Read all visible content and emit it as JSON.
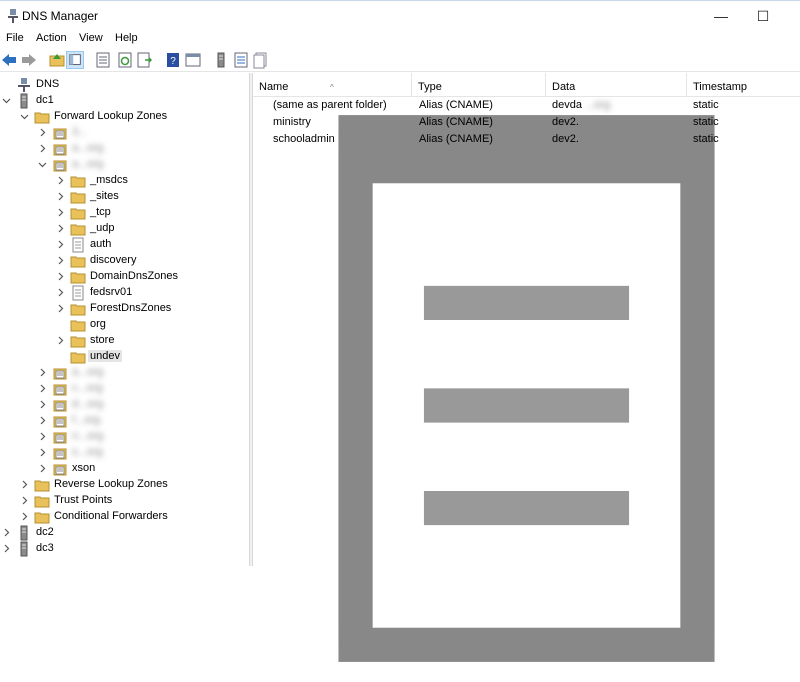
{
  "window": {
    "title": "DNS Manager",
    "minimize": "—",
    "maximize": "☐"
  },
  "menu": [
    "File",
    "Action",
    "View",
    "Help"
  ],
  "toolbar": [
    "back-arrow-icon",
    "forward-arrow-icon",
    "up-folder-icon",
    "show-tree-icon",
    "properties-icon",
    "refresh-icon",
    "export-list-icon",
    "help-icon",
    "console-icon",
    "server-icon",
    "list-icon",
    "document-icon"
  ],
  "tree": {
    "root": "DNS",
    "dc1": "dc1",
    "forward_lookup_zones": "Forward Lookup Zones",
    "zones": [
      {
        "label": "3..."
      },
      {
        "label": "a...org"
      },
      {
        "label": "a...org"
      }
    ],
    "subfolders": [
      "_msdcs",
      "_sites",
      "_tcp",
      "_udp",
      "auth",
      "discovery",
      "DomainDnsZones",
      "fedsrv01",
      "ForestDnsZones",
      "org",
      "store",
      "undev"
    ],
    "more_zones": [
      "a...org",
      "c...org",
      "d...org",
      "f...org",
      "n...org",
      "s...org",
      "xson"
    ],
    "reverse_lookup_zones": "Reverse Lookup Zones",
    "trust_points": "Trust Points",
    "conditional_forwarders": "Conditional Forwarders",
    "dc2": "dc2",
    "dc3": "dc3"
  },
  "list": {
    "columns": [
      "Name",
      "Type",
      "Data",
      "Timestamp"
    ],
    "rows": [
      {
        "name": "(same as parent folder)",
        "type": "Alias (CNAME)",
        "data": "devda",
        "data_hidden": "...org",
        "timestamp": "static"
      },
      {
        "name": "ministry",
        "type": "Alias (CNAME)",
        "data": "dev2.",
        "data_hidden": "",
        "timestamp": "static"
      },
      {
        "name": "schooladmin",
        "type": "Alias (CNAME)",
        "data": "dev2.",
        "data_hidden": "",
        "timestamp": "static"
      }
    ]
  },
  "colors": {
    "folder": "#e8c15a",
    "selection": "#cce4f7",
    "arrow": "#2f6fbf"
  }
}
